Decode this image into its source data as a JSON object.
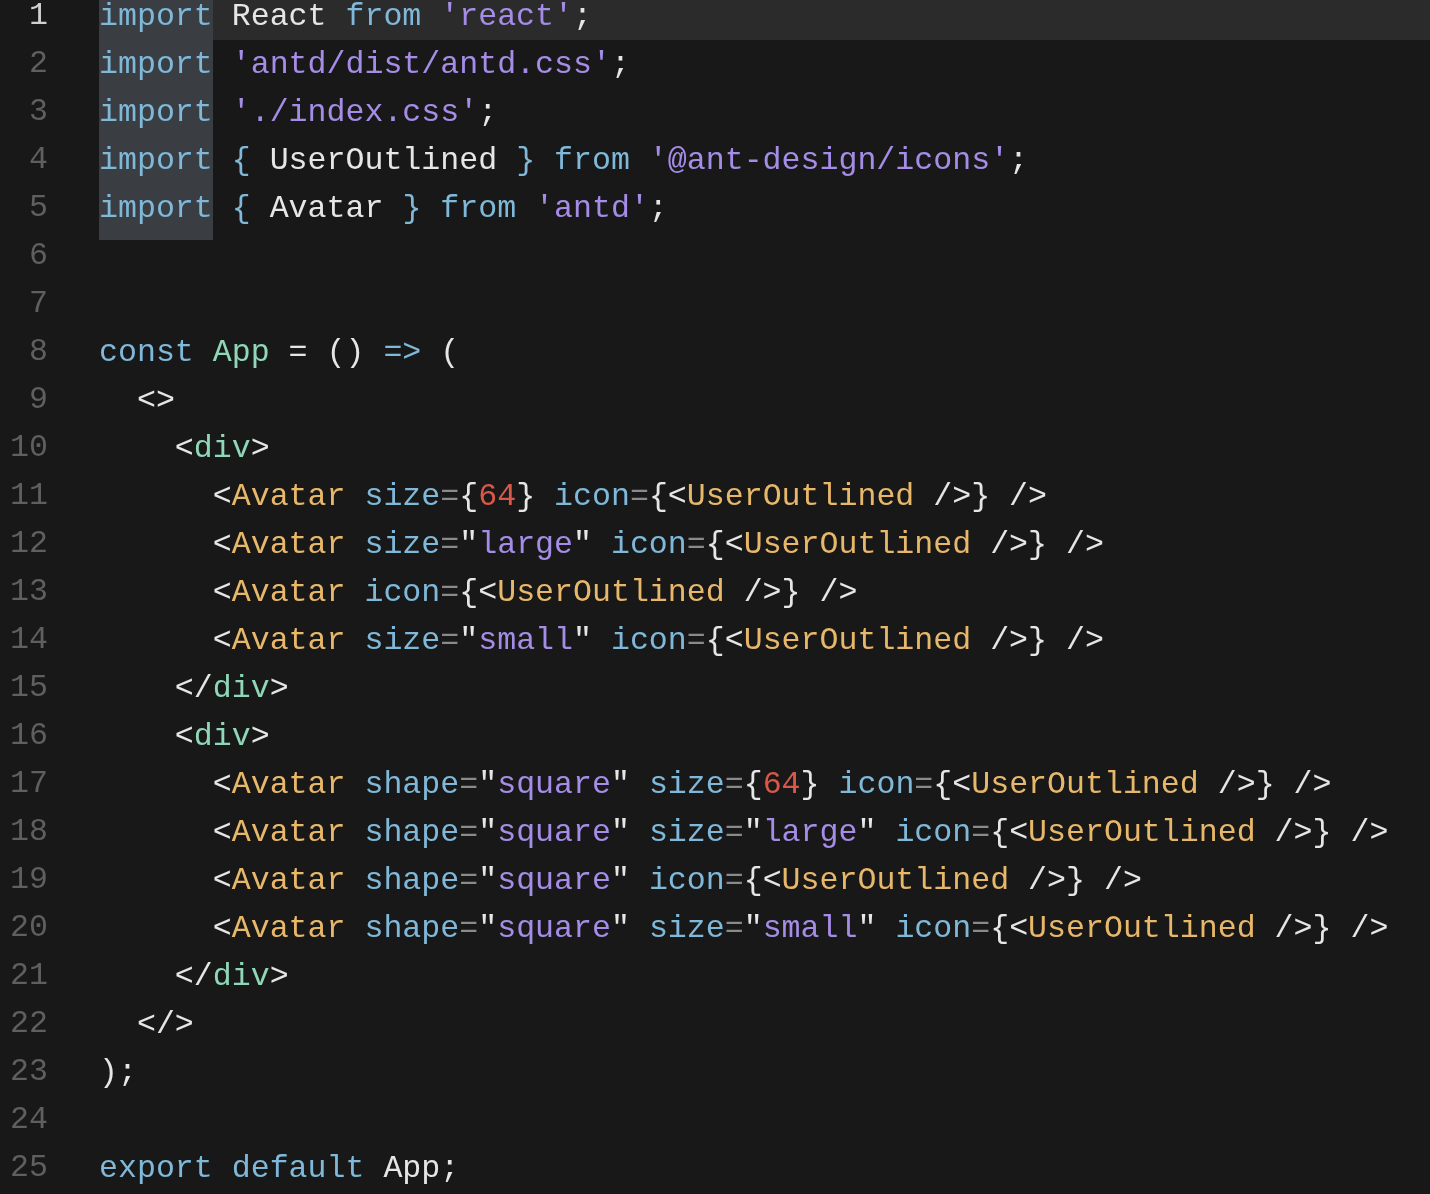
{
  "editor": {
    "lines": [
      {
        "number": "1",
        "current": true,
        "tokens": [
          {
            "text": "import",
            "kind": "kw-match"
          },
          {
            "text": " React ",
            "kind": "plain"
          },
          {
            "text": "from",
            "kind": "kw"
          },
          {
            "text": " 'react'",
            "kind": "str"
          },
          {
            "text": ";",
            "kind": "plain"
          }
        ]
      },
      {
        "number": "2",
        "current": false,
        "tokens": [
          {
            "text": "import",
            "kind": "kw-match"
          },
          {
            "text": " 'antd/dist/antd.css'",
            "kind": "str"
          },
          {
            "text": ";",
            "kind": "plain"
          }
        ]
      },
      {
        "number": "3",
        "current": false,
        "tokens": [
          {
            "text": "import",
            "kind": "kw-match"
          },
          {
            "text": " './index.css'",
            "kind": "str"
          },
          {
            "text": ";",
            "kind": "plain"
          }
        ]
      },
      {
        "number": "4",
        "current": false,
        "tokens": [
          {
            "text": "import",
            "kind": "kw-match"
          },
          {
            "text": " {",
            "kind": "kw"
          },
          {
            "text": " UserOutlined ",
            "kind": "plain"
          },
          {
            "text": "} from",
            "kind": "kw"
          },
          {
            "text": " '@ant-design/icons'",
            "kind": "str"
          },
          {
            "text": ";",
            "kind": "plain"
          }
        ]
      },
      {
        "number": "5",
        "current": false,
        "tokens": [
          {
            "text": "import",
            "kind": "kw-match"
          },
          {
            "text": " {",
            "kind": "kw"
          },
          {
            "text": " Avatar ",
            "kind": "plain"
          },
          {
            "text": "} from",
            "kind": "kw"
          },
          {
            "text": " 'antd'",
            "kind": "str"
          },
          {
            "text": ";",
            "kind": "plain"
          }
        ]
      },
      {
        "number": "6",
        "current": false
      },
      {
        "number": "7",
        "current": false
      },
      {
        "number": "8",
        "current": false,
        "tokens": [
          {
            "text": "const",
            "kind": "kw"
          },
          {
            "text": " App",
            "kind": "fn"
          },
          {
            "text": " = () ",
            "kind": "plain"
          },
          {
            "text": "=>",
            "kind": "kw"
          },
          {
            "text": " (",
            "kind": "plain"
          }
        ]
      },
      {
        "number": "9",
        "current": false,
        "tokens": [
          {
            "text": "  <>",
            "kind": "plain"
          }
        ]
      },
      {
        "number": "10",
        "current": false,
        "tokens": [
          {
            "text": "    <",
            "kind": "plain"
          },
          {
            "text": "div",
            "kind": "fn"
          },
          {
            "text": ">",
            "kind": "plain"
          }
        ]
      },
      {
        "number": "11",
        "current": false,
        "tokens": [
          {
            "text": "      <",
            "kind": "plain"
          },
          {
            "text": "Avatar",
            "kind": "tag"
          },
          {
            "text": " size",
            "kind": "attr"
          },
          {
            "text": "=",
            "kind": "op"
          },
          {
            "text": "{",
            "kind": "plain"
          },
          {
            "text": "64",
            "kind": "num"
          },
          {
            "text": "} ",
            "kind": "plain"
          },
          {
            "text": "icon",
            "kind": "attr"
          },
          {
            "text": "=",
            "kind": "op"
          },
          {
            "text": "{<",
            "kind": "plain"
          },
          {
            "text": "UserOutlined",
            "kind": "tag"
          },
          {
            "text": " />} />",
            "kind": "plain"
          }
        ]
      },
      {
        "number": "12",
        "current": false,
        "tokens": [
          {
            "text": "      <",
            "kind": "plain"
          },
          {
            "text": "Avatar",
            "kind": "tag"
          },
          {
            "text": " size",
            "kind": "attr"
          },
          {
            "text": "=",
            "kind": "op"
          },
          {
            "text": "\"",
            "kind": "plain"
          },
          {
            "text": "large",
            "kind": "str"
          },
          {
            "text": "\" ",
            "kind": "plain"
          },
          {
            "text": "icon",
            "kind": "attr"
          },
          {
            "text": "=",
            "kind": "op"
          },
          {
            "text": "{<",
            "kind": "plain"
          },
          {
            "text": "UserOutlined",
            "kind": "tag"
          },
          {
            "text": " />} />",
            "kind": "plain"
          }
        ]
      },
      {
        "number": "13",
        "current": false,
        "tokens": [
          {
            "text": "      <",
            "kind": "plain"
          },
          {
            "text": "Avatar",
            "kind": "tag"
          },
          {
            "text": " icon",
            "kind": "attr"
          },
          {
            "text": "=",
            "kind": "op"
          },
          {
            "text": "{<",
            "kind": "plain"
          },
          {
            "text": "UserOutlined",
            "kind": "tag"
          },
          {
            "text": " />} />",
            "kind": "plain"
          }
        ]
      },
      {
        "number": "14",
        "current": false,
        "tokens": [
          {
            "text": "      <",
            "kind": "plain"
          },
          {
            "text": "Avatar",
            "kind": "tag"
          },
          {
            "text": " size",
            "kind": "attr"
          },
          {
            "text": "=",
            "kind": "op"
          },
          {
            "text": "\"",
            "kind": "plain"
          },
          {
            "text": "small",
            "kind": "str"
          },
          {
            "text": "\" ",
            "kind": "plain"
          },
          {
            "text": "icon",
            "kind": "attr"
          },
          {
            "text": "=",
            "kind": "op"
          },
          {
            "text": "{<",
            "kind": "plain"
          },
          {
            "text": "UserOutlined",
            "kind": "tag"
          },
          {
            "text": " />} />",
            "kind": "plain"
          }
        ]
      },
      {
        "number": "15",
        "current": false,
        "tokens": [
          {
            "text": "    </",
            "kind": "plain"
          },
          {
            "text": "div",
            "kind": "fn"
          },
          {
            "text": ">",
            "kind": "plain"
          }
        ]
      },
      {
        "number": "16",
        "current": false,
        "tokens": [
          {
            "text": "    <",
            "kind": "plain"
          },
          {
            "text": "div",
            "kind": "fn"
          },
          {
            "text": ">",
            "kind": "plain"
          }
        ]
      },
      {
        "number": "17",
        "current": false,
        "tokens": [
          {
            "text": "      <",
            "kind": "plain"
          },
          {
            "text": "Avatar",
            "kind": "tag"
          },
          {
            "text": " shape",
            "kind": "attr"
          },
          {
            "text": "=",
            "kind": "op"
          },
          {
            "text": "\"",
            "kind": "plain"
          },
          {
            "text": "square",
            "kind": "str"
          },
          {
            "text": "\" ",
            "kind": "plain"
          },
          {
            "text": "size",
            "kind": "attr"
          },
          {
            "text": "=",
            "kind": "op"
          },
          {
            "text": "{",
            "kind": "plain"
          },
          {
            "text": "64",
            "kind": "num"
          },
          {
            "text": "} ",
            "kind": "plain"
          },
          {
            "text": "icon",
            "kind": "attr"
          },
          {
            "text": "=",
            "kind": "op"
          },
          {
            "text": "{<",
            "kind": "plain"
          },
          {
            "text": "UserOutlined",
            "kind": "tag"
          },
          {
            "text": " />} />",
            "kind": "plain"
          }
        ]
      },
      {
        "number": "18",
        "current": false,
        "tokens": [
          {
            "text": "      <",
            "kind": "plain"
          },
          {
            "text": "Avatar",
            "kind": "tag"
          },
          {
            "text": " shape",
            "kind": "attr"
          },
          {
            "text": "=",
            "kind": "op"
          },
          {
            "text": "\"",
            "kind": "plain"
          },
          {
            "text": "square",
            "kind": "str"
          },
          {
            "text": "\" ",
            "kind": "plain"
          },
          {
            "text": "size",
            "kind": "attr"
          },
          {
            "text": "=",
            "kind": "op"
          },
          {
            "text": "\"",
            "kind": "plain"
          },
          {
            "text": "large",
            "kind": "str"
          },
          {
            "text": "\" ",
            "kind": "plain"
          },
          {
            "text": "icon",
            "kind": "attr"
          },
          {
            "text": "=",
            "kind": "op"
          },
          {
            "text": "{<",
            "kind": "plain"
          },
          {
            "text": "UserOutlined",
            "kind": "tag"
          },
          {
            "text": " />} />",
            "kind": "plain"
          }
        ]
      },
      {
        "number": "19",
        "current": false,
        "tokens": [
          {
            "text": "      <",
            "kind": "plain"
          },
          {
            "text": "Avatar",
            "kind": "tag"
          },
          {
            "text": " shape",
            "kind": "attr"
          },
          {
            "text": "=",
            "kind": "op"
          },
          {
            "text": "\"",
            "kind": "plain"
          },
          {
            "text": "square",
            "kind": "str"
          },
          {
            "text": "\" ",
            "kind": "plain"
          },
          {
            "text": "icon",
            "kind": "attr"
          },
          {
            "text": "=",
            "kind": "op"
          },
          {
            "text": "{<",
            "kind": "plain"
          },
          {
            "text": "UserOutlined",
            "kind": "tag"
          },
          {
            "text": " />} />",
            "kind": "plain"
          }
        ]
      },
      {
        "number": "20",
        "current": false,
        "tokens": [
          {
            "text": "      <",
            "kind": "plain"
          },
          {
            "text": "Avatar",
            "kind": "tag"
          },
          {
            "text": " shape",
            "kind": "attr"
          },
          {
            "text": "=",
            "kind": "op"
          },
          {
            "text": "\"",
            "kind": "plain"
          },
          {
            "text": "square",
            "kind": "str"
          },
          {
            "text": "\" ",
            "kind": "plain"
          },
          {
            "text": "size",
            "kind": "attr"
          },
          {
            "text": "=",
            "kind": "op"
          },
          {
            "text": "\"",
            "kind": "plain"
          },
          {
            "text": "small",
            "kind": "str"
          },
          {
            "text": "\" ",
            "kind": "plain"
          },
          {
            "text": "icon",
            "kind": "attr"
          },
          {
            "text": "=",
            "kind": "op"
          },
          {
            "text": "{<",
            "kind": "plain"
          },
          {
            "text": "UserOutlined",
            "kind": "tag"
          },
          {
            "text": " />} />",
            "kind": "plain"
          }
        ]
      },
      {
        "number": "21",
        "current": false,
        "tokens": [
          {
            "text": "    </",
            "kind": "plain"
          },
          {
            "text": "div",
            "kind": "fn"
          },
          {
            "text": ">",
            "kind": "plain"
          }
        ]
      },
      {
        "number": "22",
        "current": false,
        "tokens": [
          {
            "text": "  </>",
            "kind": "plain"
          }
        ]
      },
      {
        "number": "23",
        "current": false,
        "tokens": [
          {
            "text": ");",
            "kind": "plain"
          }
        ]
      },
      {
        "number": "24",
        "current": false
      },
      {
        "number": "25",
        "current": false,
        "tokens": [
          {
            "text": "export default",
            "kind": "kw"
          },
          {
            "text": " App;",
            "kind": "plain"
          }
        ]
      }
    ]
  }
}
